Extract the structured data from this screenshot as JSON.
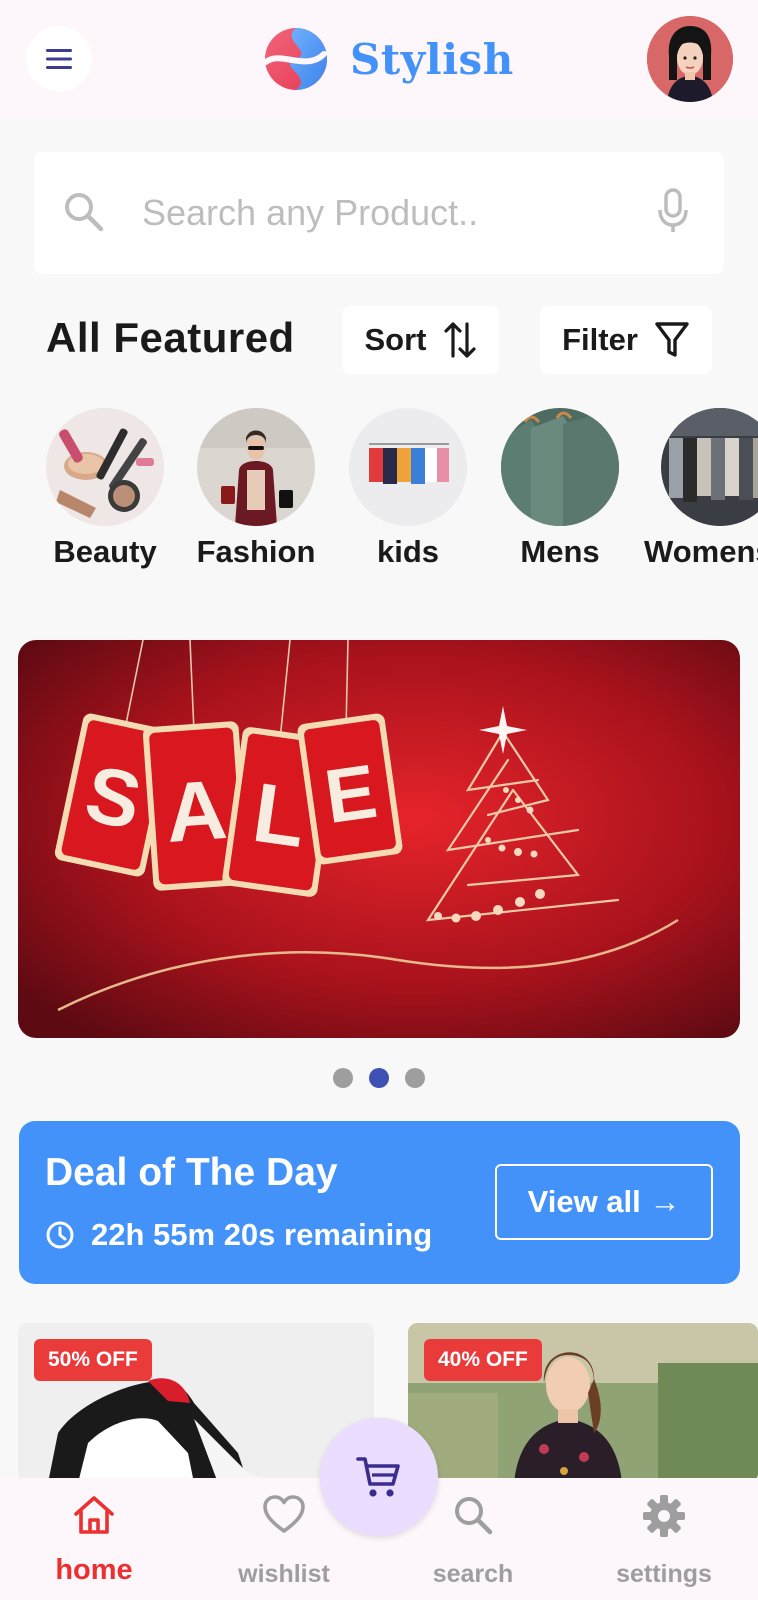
{
  "header": {
    "brand_name": "Stylish",
    "menu_icon": "hamburger-menu-icon",
    "avatar": "user-avatar"
  },
  "search": {
    "placeholder": "Search any Product..",
    "value": "",
    "left_icon": "search-icon",
    "right_icon": "mic-icon"
  },
  "featured": {
    "title": "All Featured",
    "sort_label": "Sort",
    "sort_icon": "sort-arrows-icon",
    "filter_label": "Filter",
    "filter_icon": "filter-funnel-icon"
  },
  "categories": [
    {
      "label": "Beauty"
    },
    {
      "label": "Fashion"
    },
    {
      "label": "kids"
    },
    {
      "label": "Mens"
    },
    {
      "label": "Womens"
    }
  ],
  "banner": {
    "sale_letters": [
      "S",
      "A",
      "L",
      "E"
    ],
    "carousel_count": 3,
    "carousel_active_index": 1
  },
  "deal": {
    "title": "Deal of The Day",
    "timer_text": "22h 55m 20s remaining",
    "view_all_label": "View all →",
    "timer_icon": "clock-icon"
  },
  "products": [
    {
      "badge": "50% OFF"
    },
    {
      "badge": "40% OFF"
    }
  ],
  "bottom_nav": {
    "items": [
      {
        "label": "home",
        "icon": "home-icon",
        "active": true
      },
      {
        "label": "wishlist",
        "icon": "heart-icon",
        "active": false
      },
      {
        "label": "search",
        "icon": "search-icon",
        "active": false
      },
      {
        "label": "settings",
        "icon": "gear-icon",
        "active": false
      }
    ],
    "fab_icon": "cart-icon"
  },
  "colors": {
    "accent_blue": "#4392f9",
    "active_red": "#eb3030",
    "badge_red": "#ea3b3b",
    "indicator_active": "#3f51b5",
    "fab_background": "#eaddff"
  }
}
